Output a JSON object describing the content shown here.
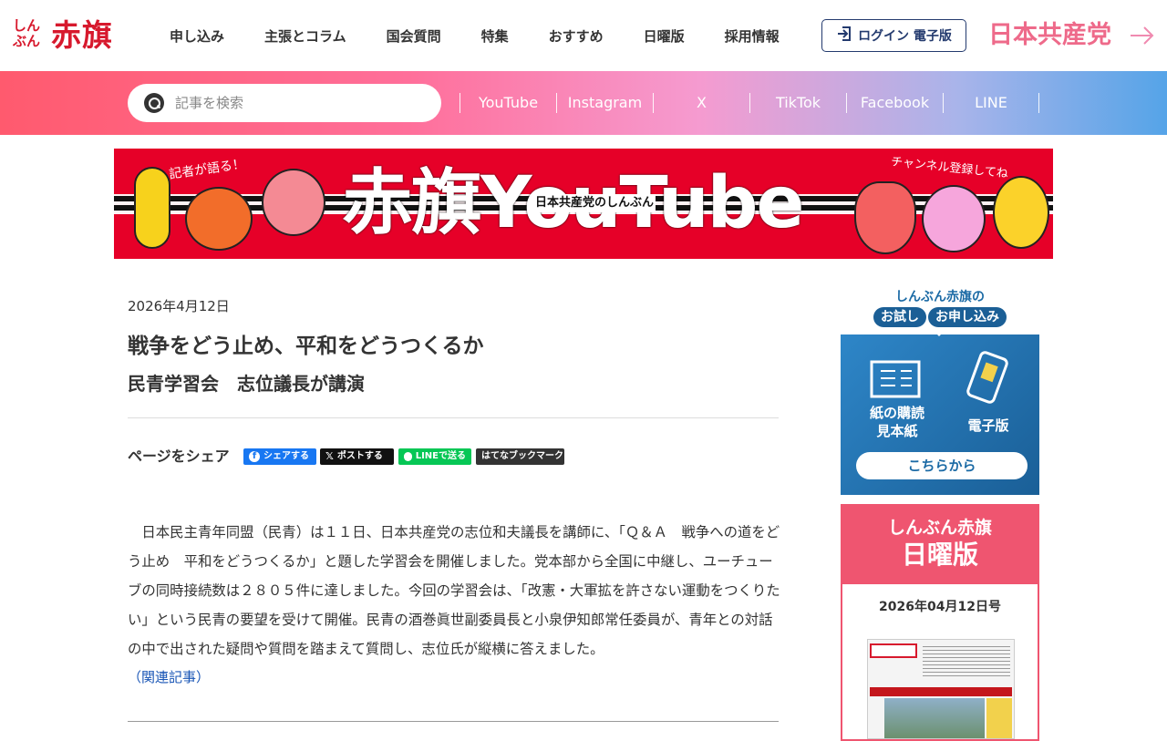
{
  "header": {
    "logo_small": "しんぶん",
    "logo_big": "赤旗",
    "nav": [
      "申し込み",
      "主張とコラム",
      "国会質問",
      "特集",
      "おすすめ",
      "日曜版",
      "採用情報"
    ],
    "login_label": "ログイン 電子版",
    "party_logo": "日本共産党"
  },
  "search": {
    "placeholder": "記事を検索"
  },
  "social": [
    "YouTube",
    "Instagram",
    "X",
    "TikTok",
    "Facebook",
    "LINE"
  ],
  "banner": {
    "title": "赤旗YouTube",
    "sub": "日本共産党のしんぶん",
    "tag_left": "記者が語る！",
    "tag_right": "チャンネル登録してね"
  },
  "article": {
    "date": "2026年4月12日",
    "headline": "戦争をどう止め、平和をどうつくるか",
    "subhead": "民青学習会　志位議長が講演",
    "share_label": "ページをシェア",
    "share_buttons": {
      "facebook": "シェアする",
      "x": "ポストする",
      "line": "LINEで送る",
      "hatena": "はてなブックマーク"
    },
    "body": "　日本民主青年同盟（民青）は１１日、日本共産党の志位和夫議長を講師に、「Ｑ＆Ａ　戦争への道をどう止め　平和をどうつくるか」と題した学習会を開催しました。党本部から全国に中継し、ユーチューブの同時接続数は２８０５件に達しました。今回の学習会は、「改憲・大軍拡を許さない運動をつくりたい」という民青の要望を受けて開催。民青の酒巻眞世副委員長と小泉伊知郎常任委員が、青年との対話の中で出された疑問や質問を踏まえて質問し、志位氏が縦横に答えました。",
    "related": "（関連記事）"
  },
  "sidebar": {
    "trial_title": "しんぶん赤旗の",
    "trial_pill1": "お試し",
    "trial_pill2": "お申し込み",
    "opt_paper": "紙の購読\n見本紙",
    "opt_paper_l1": "紙の購読",
    "opt_paper_l2": "見本紙",
    "opt_digital": "電子版",
    "cta": "こちらから",
    "sunday_l1": "しんぶん赤旗",
    "sunday_l2": "日曜版",
    "sunday_issue": "2026年04月12日号"
  },
  "colors": {
    "brand_red": "#d7192d",
    "navy": "#233a6e",
    "sidebar_blue": "#1b5f96",
    "sunday_pink": "#ef5570",
    "link_blue": "#1a56b6"
  }
}
